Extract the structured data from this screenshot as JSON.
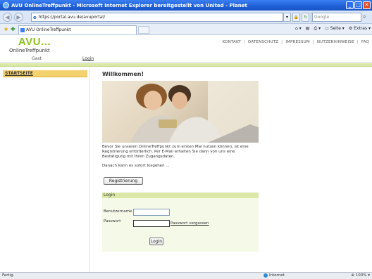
{
  "window": {
    "title": "AVU OnlineTreffpunkt - Microsoft Internet Explorer bereitgestellt von United - Planet"
  },
  "browser": {
    "url": "https://portal.avu.de/avuportal/",
    "search_placeholder": "Google",
    "tab_title": "AVU OnlineTreffpunkt",
    "commands": [
      "Seite",
      "Extras"
    ],
    "status_left": "Fertig",
    "status_zone": "Internet",
    "zoom": "100%"
  },
  "site": {
    "logo_text": "AVU...",
    "logo_subtitle": "OnlineTreffpunkt",
    "topnav": [
      "KONTAKT",
      "DATENSCHUTZ",
      "IMPRESSUM",
      "NUTZERHINWEISE",
      "FAQ"
    ],
    "user_label": "Gast",
    "login_link": "Login",
    "sidebar_items": [
      "STARTSEITE"
    ]
  },
  "main": {
    "heading": "Willkommen!",
    "intro": "Bevor Sie unseren OnlineTreffpunkt zum ersten Mal nutzen können, ist eine Registrierung erforderlich. Per E-Mail erhalten Sie dann von uns eine Bestätigung mit Ihren Zugangsdaten.",
    "intro2": "Danach kann es sofort losgehen ...",
    "register_button": "Registrierung"
  },
  "login": {
    "title": "Login",
    "username_label": "Benutzername",
    "password_label": "Passwort",
    "forgot_link": "Passwort vergessen",
    "submit": "Login"
  }
}
